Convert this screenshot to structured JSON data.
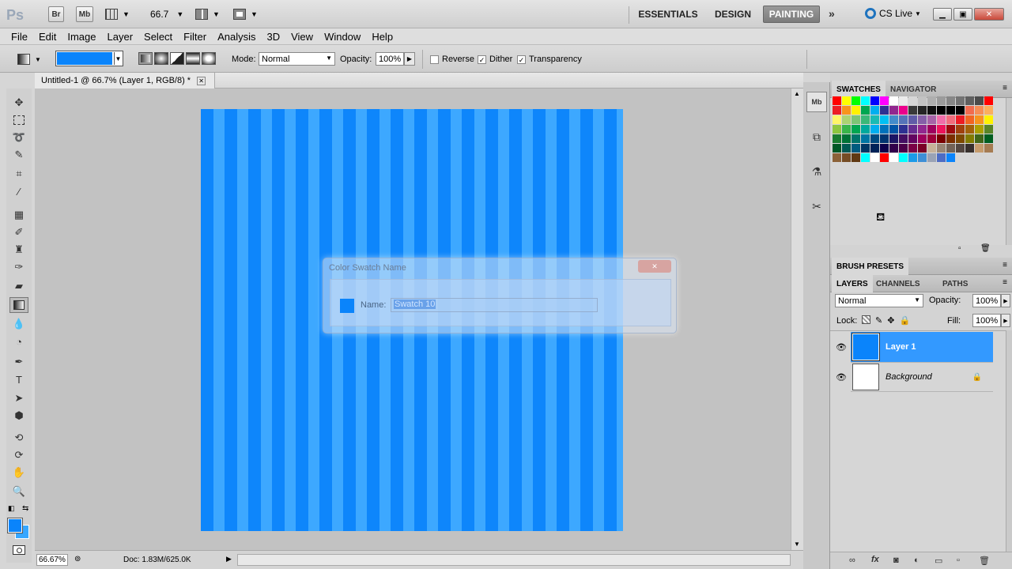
{
  "appbar": {
    "logo": "Ps",
    "bridge": "Br",
    "minibridge": "Mb",
    "zoom": "66.7",
    "workspaces": [
      "ESSENTIALS",
      "DESIGN",
      "PAINTING"
    ],
    "active_workspace": "PAINTING",
    "cslive": "CS Live"
  },
  "menu": [
    "File",
    "Edit",
    "Image",
    "Layer",
    "Select",
    "Filter",
    "Analysis",
    "3D",
    "View",
    "Window",
    "Help"
  ],
  "options": {
    "gradient_color": "#0a84fb",
    "mode_label": "Mode:",
    "mode_value": "Normal",
    "opacity_label": "Opacity:",
    "opacity_value": "100%",
    "reverse_label": "Reverse",
    "reverse_checked": false,
    "dither_label": "Dither",
    "dither_checked": true,
    "transparency_label": "Transparency",
    "transparency_checked": true
  },
  "document": {
    "tab_title": "Untitled-1 @ 66.7% (Layer 1, RGB/8) *",
    "stripe_colors": [
      "#0e86fb",
      "#3da8ff"
    ]
  },
  "status": {
    "zoom": "66.67%",
    "doc": "Doc: 1.83M/625.0K"
  },
  "dialog": {
    "title": "Color Swatch Name",
    "name_label": "Name:",
    "name_value": "Swatch 10",
    "swatch_color": "#0a84fb"
  },
  "panels": {
    "top_tabs": [
      "SWATCHES",
      "NAVIGATOR"
    ],
    "brush_presets": "BRUSH PRESETS",
    "layer_tabs": [
      "LAYERS",
      "CHANNELS",
      "PATHS"
    ],
    "blend_mode": "Normal",
    "opacity_label": "Opacity:",
    "opacity_value": "100%",
    "lock_label": "Lock:",
    "fill_label": "Fill:",
    "fill_value": "100%",
    "layers": [
      {
        "name": "Layer 1",
        "color": "#0a84fb",
        "selected": true
      },
      {
        "name": "Background",
        "color": "#ffffff",
        "selected": false
      }
    ]
  },
  "swatches": [
    "#ff0000",
    "#ffff00",
    "#00ff00",
    "#00ffff",
    "#0000ff",
    "#ff00ff",
    "#ffffff",
    "#ebebeb",
    "#d7d7d7",
    "#c3c3c3",
    "#afafaf",
    "#9b9b9b",
    "#878787",
    "#737373",
    "#5f5f5f",
    "#4b4b4b",
    "#ff0000",
    "#ed1c24",
    "#f7941d",
    "#fff200",
    "#00a651",
    "#00aeef",
    "#2e3192",
    "#92278f",
    "#ec008c",
    "#393939",
    "#252525",
    "#111111",
    "#000000",
    "#000000",
    "#000000",
    "#f26c4f",
    "#f68e56",
    "#fbaf5d",
    "#fff568",
    "#acd372",
    "#7cc576",
    "#3bb878",
    "#1abbb4",
    "#00bff3",
    "#448ccb",
    "#5574b9",
    "#605ca8",
    "#855fa8",
    "#a763a8",
    "#f06ea9",
    "#f26d7d",
    "#ed1c24",
    "#f26522",
    "#f7941d",
    "#fff200",
    "#8dc63f",
    "#39b54a",
    "#00a651",
    "#00a99d",
    "#00aeef",
    "#0072bc",
    "#0054a6",
    "#2e3192",
    "#662d91",
    "#92278f",
    "#9e005d",
    "#ed145b",
    "#9e0b0f",
    "#a0410d",
    "#a36209",
    "#aba000",
    "#598527",
    "#197b30",
    "#007236",
    "#00746b",
    "#0076a3",
    "#004a80",
    "#003471",
    "#1b1464",
    "#440e62",
    "#630460",
    "#9e005d",
    "#9e0039",
    "#790000",
    "#7b2e00",
    "#7d4900",
    "#827b00",
    "#406618",
    "#005e20",
    "#005826",
    "#005952",
    "#005b7f",
    "#003663",
    "#002157",
    "#0d004c",
    "#32004b",
    "#4b0049",
    "#7b0046",
    "#7a0026",
    "#c7b299",
    "#998675",
    "#736357",
    "#534741",
    "#37302d",
    "#c69c6d",
    "#a67c52",
    "#8c6239",
    "#754c24",
    "#603913",
    "#00ffff",
    "#ffffff",
    "#ff0000",
    "#ffffff",
    "#00ffff",
    "#1c9be8",
    "#3e8fd6",
    "#9aa3b5",
    "#4d6cc4",
    "#0a84fb"
  ],
  "colors": {
    "foreground": "#0a84fb",
    "background": "#38a7ff"
  }
}
